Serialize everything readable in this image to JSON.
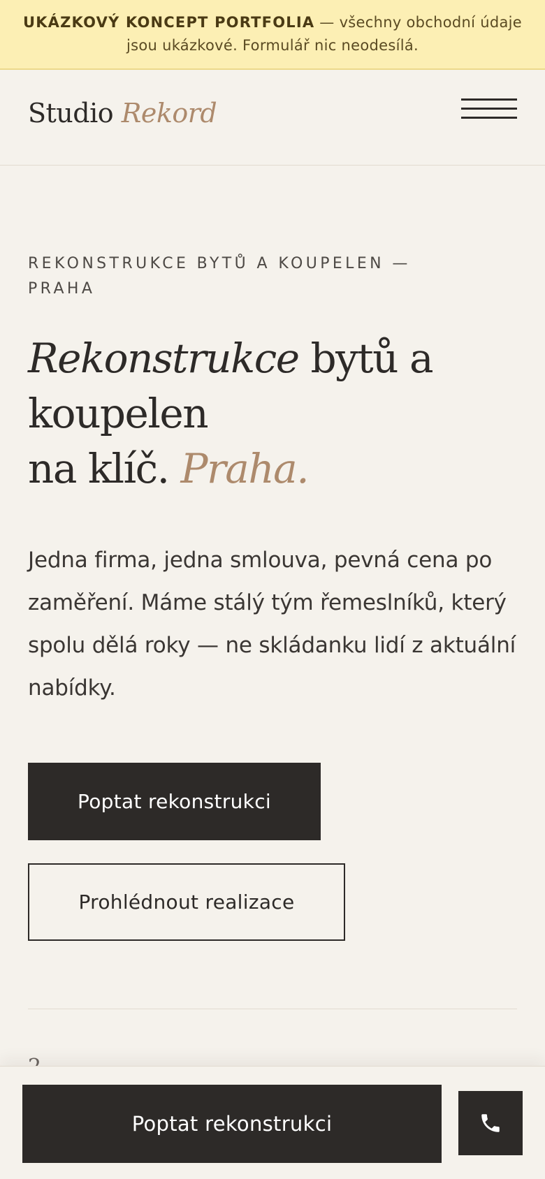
{
  "banner": {
    "strong": "UKÁZKOVÝ KONCEPT PORTFOLIA",
    "text": " — všechny obchodní údaje jsou ukázkové. Formulář nic neodesílá."
  },
  "header": {
    "logo_main": "Studio ",
    "logo_accent": "Rekord",
    "menu_icon": "hamburger-menu-icon"
  },
  "hero": {
    "eyebrow": "Rekonstrukce bytů a koupelen — Praha",
    "headline_italic": "Rekonstrukce",
    "headline_line1_rest": " bytů a",
    "headline_line2": "koupelen",
    "headline_line3": "na klíč. ",
    "headline_accent": "Praha.",
    "lead": "Jedna firma, jedna smlouva, pevná cena po zaměření. Máme stálý tým řemeslníků, který spolu dělá roky — ne skládanku lidí z aktuální nabídky.",
    "cta_primary": "Poptat rekonstrukci",
    "cta_secondary": "Prohlédnout realizace"
  },
  "next_section": {
    "peek_text": "2"
  },
  "bottom_bar": {
    "cta": "Poptat rekonstrukci",
    "phone_icon": "phone-icon"
  },
  "colors": {
    "background": "#f5f2ec",
    "banner": "#fcefb4",
    "dark": "#2d2a28",
    "accent": "#ad8a6c"
  }
}
